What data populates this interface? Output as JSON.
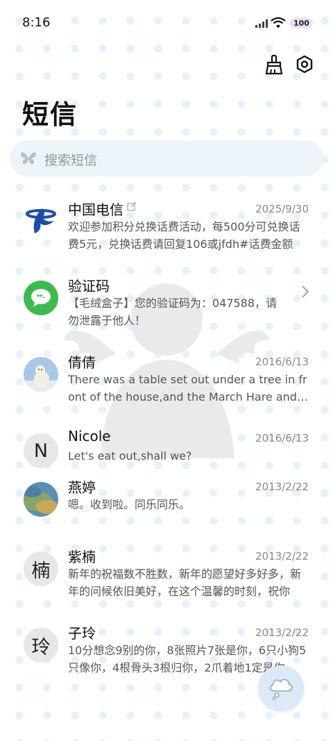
{
  "status_bar": {
    "time": "8:16",
    "battery": "100"
  },
  "header": {
    "title": "短信",
    "clean_icon": "broom-icon",
    "settings_icon": "gear-icon"
  },
  "search": {
    "placeholder": "搜索短信",
    "icon": "butterfly-icon"
  },
  "messages": [
    {
      "name": "中国电信",
      "date": "2025/9/30",
      "preview": "欢迎参加积分兑换话费活动，每500分可兑换话费5元，兑换话费请回复106或jfdh#话费金额",
      "avatar": "china-telecom-logo"
    },
    {
      "name": "验证码",
      "date": "",
      "preview": "【毛绒盒子】您的验证码为：047588，请勿泄露于他人！",
      "avatar": "message-bubble-icon"
    },
    {
      "name": "倩倩",
      "date": "2016/6/13",
      "preview": "There was a table set out under a tree in front of the house,and the March Hare and the Hatter",
      "avatar": "polar-bear-photo"
    },
    {
      "name": "Nicole",
      "date": "2016/6/13",
      "preview": "Let's eat out,shall we?",
      "avatar_letter": "N"
    },
    {
      "name": "燕婷",
      "date": "2013/2/22",
      "preview": "嗯。收到啦。同乐同乐。",
      "avatar": "landscape-photo"
    },
    {
      "name": "紫楠",
      "date": "2013/2/22",
      "preview": "新年的祝福数不胜数，新年的愿望好多好多，新年的问候依旧美好，在这个温馨的时刻，祝你",
      "avatar_letter": "楠"
    },
    {
      "name": "子玲",
      "date": "2013/2/22",
      "preview": "10分想念9别的你，8张照片7张是你，6只小狗5只像你，4根骨头3根归你，2爪着地1定是你",
      "avatar_letter": "玲"
    }
  ],
  "fab": {
    "icon": "new-message-cloud-icon"
  }
}
